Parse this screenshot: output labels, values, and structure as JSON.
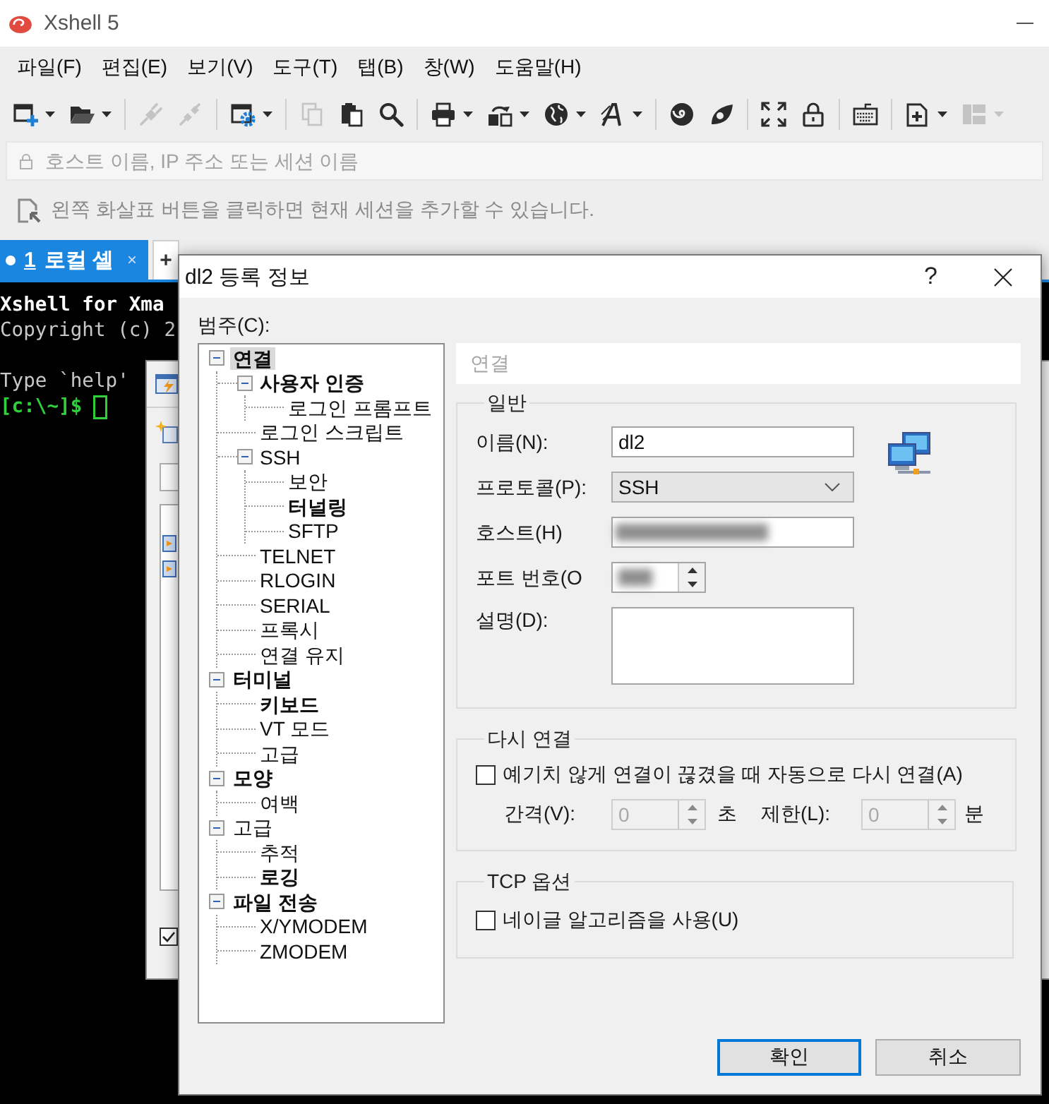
{
  "window": {
    "title": "Xshell 5"
  },
  "menu": [
    {
      "label": "파일(F)"
    },
    {
      "label": "편집(E)"
    },
    {
      "label": "보기(V)"
    },
    {
      "label": "도구(T)"
    },
    {
      "label": "탭(B)"
    },
    {
      "label": "창(W)"
    },
    {
      "label": "도움말(H)"
    }
  ],
  "toolbar": [
    [
      {
        "dropdown": true,
        "disabled": false
      },
      {
        "dropdown": true,
        "disabled": false
      }
    ],
    [
      {
        "dropdown": false,
        "disabled": true
      },
      {
        "dropdown": false,
        "disabled": true
      }
    ],
    [
      {
        "dropdown": true,
        "disabled": false
      }
    ],
    [
      {
        "dropdown": false,
        "disabled": true
      },
      {
        "dropdown": false,
        "disabled": false
      },
      {
        "dropdown": false,
        "disabled": false
      }
    ],
    [
      {
        "dropdown": true,
        "disabled": false
      },
      {
        "dropdown": true,
        "disabled": false
      },
      {
        "dropdown": true,
        "disabled": false
      },
      {
        "dropdown": true,
        "disabled": false
      }
    ],
    [
      {
        "dropdown": false,
        "disabled": false
      },
      {
        "dropdown": false,
        "disabled": false
      }
    ],
    [
      {
        "dropdown": false,
        "disabled": false
      },
      {
        "dropdown": false,
        "disabled": false
      }
    ],
    [
      {
        "dropdown": false,
        "disabled": false
      }
    ],
    [
      {
        "dropdown": true,
        "disabled": false
      },
      {
        "dropdown": true,
        "disabled": true
      }
    ]
  ],
  "address_bar": {
    "placeholder": "호스트 이름, IP 주소 또는 세션 이름"
  },
  "hint_bar": {
    "text": "왼쪽 화살표 버튼을 클릭하면 현재 세션을 추가할 수 있습니다."
  },
  "tabs": [
    {
      "number": "1",
      "label": "로컬 셸",
      "close": "×",
      "selected": true
    }
  ],
  "new_tab": {
    "label": "+"
  },
  "terminal": {
    "lines": [
      {
        "kind": "banner",
        "text": "Xshell for Xma"
      },
      {
        "kind": "output",
        "text": "Copyright (c) 2"
      },
      {
        "kind": "blank"
      },
      {
        "kind": "output",
        "text": "Type `help'"
      },
      {
        "kind": "prompt",
        "text": "[c:\\~]$"
      }
    ]
  },
  "background_dialog": {
    "checkbox": {
      "checked": true
    }
  },
  "dialog": {
    "title": "dl2 등록 정보",
    "help": "?",
    "category_label": "범주(C):",
    "tree": [
      {
        "label": "연결",
        "bold": true,
        "selected": true,
        "expanded": true,
        "children": [
          {
            "label": "사용자 인증",
            "bold": true,
            "selected": false,
            "expanded": true,
            "children": [
              {
                "label": "로그인 프롬프트",
                "bold": false,
                "selected": false
              }
            ]
          },
          {
            "label": "로그인 스크립트",
            "bold": false,
            "selected": false
          },
          {
            "label": "SSH",
            "bold": false,
            "selected": false,
            "expanded": true,
            "children": [
              {
                "label": "보안",
                "bold": false,
                "selected": false
              },
              {
                "label": "터널링",
                "bold": true,
                "selected": false
              },
              {
                "label": "SFTP",
                "bold": false,
                "selected": false
              }
            ]
          },
          {
            "label": "TELNET",
            "bold": false,
            "selected": false
          },
          {
            "label": "RLOGIN",
            "bold": false,
            "selected": false
          },
          {
            "label": "SERIAL",
            "bold": false,
            "selected": false
          },
          {
            "label": "프록시",
            "bold": false,
            "selected": false
          },
          {
            "label": "연결 유지",
            "bold": false,
            "selected": false
          }
        ]
      },
      {
        "label": "터미널",
        "bold": true,
        "selected": false,
        "expanded": true,
        "children": [
          {
            "label": "키보드",
            "bold": true,
            "selected": false
          },
          {
            "label": "VT 모드",
            "bold": false,
            "selected": false
          },
          {
            "label": "고급",
            "bold": false,
            "selected": false
          }
        ]
      },
      {
        "label": "모양",
        "bold": true,
        "selected": false,
        "expanded": true,
        "children": [
          {
            "label": "여백",
            "bold": false,
            "selected": false
          }
        ]
      },
      {
        "label": "고급",
        "bold": false,
        "selected": false,
        "expanded": true,
        "children": [
          {
            "label": "추적",
            "bold": false,
            "selected": false
          },
          {
            "label": "로깅",
            "bold": true,
            "selected": false
          }
        ]
      },
      {
        "label": "파일 전송",
        "bold": true,
        "selected": false,
        "expanded": true,
        "children": [
          {
            "label": "X/YMODEM",
            "bold": false,
            "selected": false
          },
          {
            "label": "ZMODEM",
            "bold": false,
            "selected": false
          }
        ]
      }
    ],
    "panel_title": "연결",
    "general": {
      "title": "일반",
      "fields": [
        {
          "kind": "text",
          "label": "이름(N):",
          "value": "dl2"
        },
        {
          "kind": "dropdown",
          "label": "프로토콜(P):",
          "value": "SSH"
        },
        {
          "kind": "text",
          "label": "호스트(H)",
          "blurred": true
        },
        {
          "kind": "spin",
          "label": "포트 번호(O",
          "blurred": true
        },
        {
          "kind": "textarea",
          "label": "설명(D):"
        }
      ]
    },
    "reconnect": {
      "title": "다시 연결",
      "checkbox": {
        "label": "예기치 않게 연결이 끊겼을 때 자동으로 다시 연결(A)",
        "checked": false
      },
      "interval": {
        "label": "간격(V):",
        "value": "0",
        "unit": "초",
        "disabled": true
      },
      "limit": {
        "label": "제한(L):",
        "value": "0",
        "unit": "분",
        "disabled": true
      }
    },
    "tcp": {
      "title": "TCP 옵션",
      "checkbox": {
        "label": "네이글 알고리즘을 사용(U)",
        "checked": false
      }
    },
    "buttons": [
      {
        "kind": "ok",
        "label": "확인",
        "default": true
      },
      {
        "kind": "cancel",
        "label": "취소",
        "default": false
      }
    ]
  }
}
